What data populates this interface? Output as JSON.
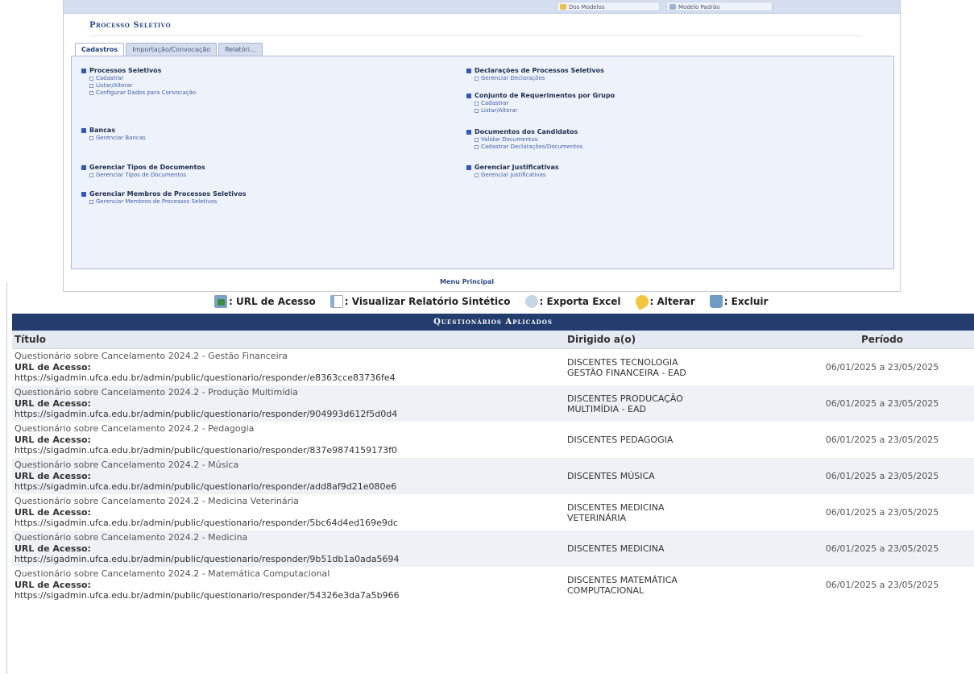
{
  "top_panel": {
    "strip_buttons": [
      "Dos Modelos",
      "Modelo Padrão"
    ],
    "title": "Processo Seletivo",
    "tabs": [
      {
        "label": "Cadastros",
        "active": true
      },
      {
        "label": "Importação/Convocação",
        "active": false
      },
      {
        "label": "Relatóri...",
        "active": false
      }
    ],
    "left_sections": [
      {
        "title": "Processos Seletivos",
        "items": [
          "Cadastrar",
          "Listar/Alterar",
          "Configurar Dados para Convocação"
        ]
      },
      {
        "title": "Bancas",
        "items": [
          "Gerenciar Bancas"
        ]
      },
      {
        "title": "Gerenciar Tipos de Documentos",
        "items": [
          "Gerenciar Tipos de Documentos"
        ]
      },
      {
        "title": "Gerenciar Membros de Processos Seletivos",
        "items": [
          "Gerenciar Membros de Processos Seletivos"
        ]
      }
    ],
    "right_sections": [
      {
        "title": "Declarações de Processos Seletivos",
        "items": [
          "Gerenciar Declarações"
        ]
      },
      {
        "title": "Conjunto de Requerimentos por Grupo",
        "items": [
          "Cadastrar",
          "Listar/Alterar"
        ]
      },
      {
        "title": "Documentos dos Candidatos",
        "items": [
          "Validar Documentos",
          "Cadastrar Declarações/Documentos"
        ]
      },
      {
        "title": "Gerenciar Justificativas",
        "items": [
          "Gerenciar Justificativas"
        ]
      }
    ],
    "menu_principal": "Menu Principal"
  },
  "legend": [
    {
      "icon": "url",
      "label": ": URL de Acesso"
    },
    {
      "icon": "rel",
      "label": ": Visualizar Relatório Sintético"
    },
    {
      "icon": "xls",
      "label": ": Exporta Excel"
    },
    {
      "icon": "alt",
      "label": ": Alterar"
    },
    {
      "icon": "exc",
      "label": ": Excluir"
    }
  ],
  "table": {
    "caption": "Questionários Aplicados",
    "headers": {
      "titulo": "Título",
      "dirigido": "Dirigido a(o)",
      "periodo": "Período"
    },
    "url_label": "URL de Acesso:",
    "rows": [
      {
        "titulo": "Questionário sobre Cancelamento 2024.2 - Gestão Financeira",
        "url": "https://sigadmin.ufca.edu.br/admin/public/questionario/responder/e8363cce83736fe4",
        "dirigido": [
          "DISCENTES TECNOLOGIA",
          "GESTÃO FINANCEIRA - EAD"
        ],
        "periodo": "06/01/2025 a 23/05/2025"
      },
      {
        "titulo": "Questionário sobre Cancelamento 2024.2 - Produção Multimídia",
        "url": "https://sigadmin.ufca.edu.br/admin/public/questionario/responder/904993d612f5d0d4",
        "dirigido": [
          "DISCENTES PRODUCAÇÃO",
          "MULTIMÍDIA - EAD"
        ],
        "periodo": "06/01/2025 a 23/05/2025"
      },
      {
        "titulo": "Questionário sobre Cancelamento 2024.2 - Pedagogia",
        "url": "https://sigadmin.ufca.edu.br/admin/public/questionario/responder/837e9874159173f0",
        "dirigido": [
          "DISCENTES PEDAGOGIA"
        ],
        "periodo": "06/01/2025 a 23/05/2025"
      },
      {
        "titulo": "Questionário sobre Cancelamento 2024.2 - Música",
        "url": "https://sigadmin.ufca.edu.br/admin/public/questionario/responder/add8af9d21e080e6",
        "dirigido": [
          "DISCENTES MÚSICA"
        ],
        "periodo": "06/01/2025 a 23/05/2025"
      },
      {
        "titulo": "Questionário sobre Cancelamento 2024.2 - Medicina Veterinária",
        "url": "https://sigadmin.ufca.edu.br/admin/public/questionario/responder/5bc64d4ed169e9dc",
        "dirigido": [
          "DISCENTES MEDICINA",
          "VETERINÁRIA"
        ],
        "periodo": "06/01/2025 a 23/05/2025"
      },
      {
        "titulo": "Questionário sobre Cancelamento 2024.2 - Medicina",
        "url": "https://sigadmin.ufca.edu.br/admin/public/questionario/responder/9b51db1a0ada5694",
        "dirigido": [
          "DISCENTES MEDICINA"
        ],
        "periodo": "06/01/2025 a 23/05/2025"
      },
      {
        "titulo": "Questionário sobre Cancelamento 2024.2 - Matemática Computacional",
        "url": "https://sigadmin.ufca.edu.br/admin/public/questionario/responder/54326e3da7a5b966",
        "dirigido": [
          "DISCENTES MATEMÁTICA",
          "COMPUTACIONAL"
        ],
        "periodo": "06/01/2025 a 23/05/2025"
      }
    ]
  }
}
